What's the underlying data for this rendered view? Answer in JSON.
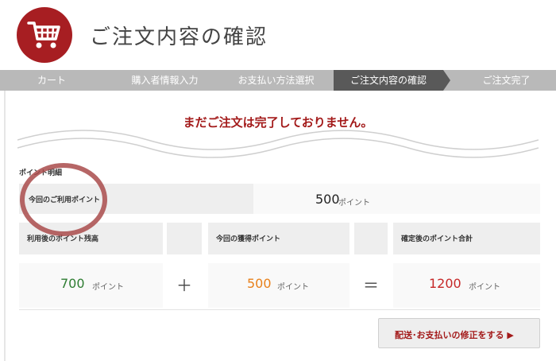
{
  "header": {
    "title": "ご注文内容の確認",
    "logo_icon": "shopping-cart-icon",
    "logo_color": "#a71e22"
  },
  "steps": [
    {
      "label": "カート",
      "active": false
    },
    {
      "label": "購入者情報入力",
      "active": false
    },
    {
      "label": "お支払い方法選択",
      "active": false
    },
    {
      "label": "ご注文内容の確認",
      "active": true
    },
    {
      "label": "ご注文完了",
      "active": false
    }
  ],
  "warning": "まだご注文は完了しておりません。",
  "points": {
    "section_title": "ポイント明細",
    "current_use_label": "今回のご利用ポイント",
    "current_use_value": "500",
    "unit": "ポイント",
    "balance_after_use_label": "利用後のポイント残高",
    "earned_label": "今回の獲得ポイント",
    "total_label": "確定後のポイント合計",
    "balance_after_use_value": "700",
    "earned_value": "500",
    "total_value": "1200",
    "plus_symbol": "＋",
    "equals_symbol": "＝",
    "colors": {
      "balance": "#2e7d32",
      "earned": "#e8801a",
      "total": "#c62828"
    }
  },
  "modify_button": "配送･お支払いの修正をする ▶"
}
